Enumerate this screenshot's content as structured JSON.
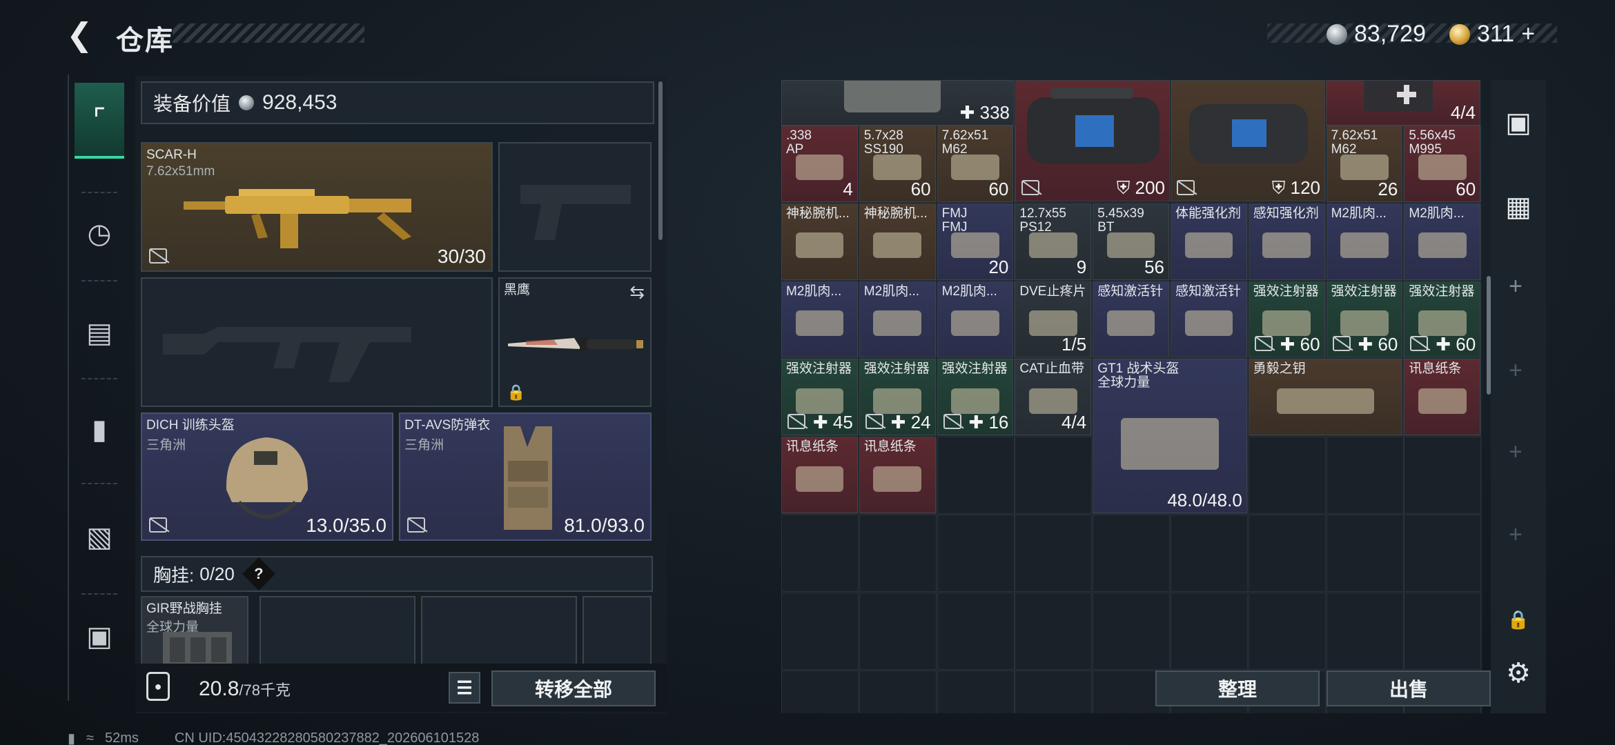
{
  "header": {
    "title": "仓库",
    "currency_silver": "83,729",
    "currency_gold": "311",
    "gold_plus": "+"
  },
  "left_rail": {
    "icons": [
      "pistol-icon",
      "armor-icon",
      "backpack-icon",
      "bag-icon",
      "clipboard-icon",
      "toolbox-icon"
    ]
  },
  "equipment": {
    "value_label": "装备价值",
    "value": "928,453",
    "primary": {
      "name": "SCAR-H",
      "caliber": "7.62x51mm",
      "ammo": "30/30"
    },
    "melee": {
      "name": "黑鹰"
    },
    "helmet": {
      "name": "DICH 训练头盔",
      "brand": "三角洲",
      "durability": "13.0/35.0"
    },
    "armor": {
      "name": "DT-AVS防弹衣",
      "brand": "三角洲",
      "durability": "81.0/93.0"
    },
    "rig": {
      "label": "胸挂:",
      "value": "0/20",
      "help": "?",
      "item_name": "GIR野战胸挂",
      "item_brand": "全球力量"
    },
    "weight": "20.8",
    "weight_cap": "/78千克",
    "transfer_all": "转移全部"
  },
  "stash": {
    "top_qty1": "338",
    "top_qty2": "4/4",
    "bag_qty1": "200",
    "bag_qty2": "120",
    "row1": [
      {
        "name": ".338\nAP",
        "qty": "4"
      },
      {
        "name": "5.7x28\nSS190",
        "qty": "60"
      },
      {
        "name": "7.62x51\nM62",
        "qty": "60"
      },
      {
        "name": "7.62x51\nM62",
        "qty": "26"
      },
      {
        "name": "5.56x45\nM995",
        "qty": "60"
      }
    ],
    "row2": [
      {
        "name": "神秘腕机...",
        "qty": ""
      },
      {
        "name": "神秘腕机...",
        "qty": ""
      },
      {
        "name": "FMJ\nFMJ",
        "qty": "20"
      },
      {
        "name": "12.7x55\nPS12",
        "qty": "9"
      },
      {
        "name": "5.45x39\nBT",
        "qty": "56"
      },
      {
        "name": "体能强化剂",
        "qty": ""
      },
      {
        "name": "感知强化剂",
        "qty": ""
      },
      {
        "name": "M2肌肉...",
        "qty": ""
      },
      {
        "name": "M2肌肉...",
        "qty": ""
      }
    ],
    "row3": [
      {
        "name": "M2肌肉...",
        "qty": ""
      },
      {
        "name": "M2肌肉...",
        "qty": ""
      },
      {
        "name": "M2肌肉...",
        "qty": ""
      },
      {
        "name": "DVE止疼片",
        "qty": "1/5"
      },
      {
        "name": "感知激活针",
        "qty": ""
      },
      {
        "name": "感知激活针",
        "qty": ""
      },
      {
        "name": "强效注射器",
        "qty": "60"
      },
      {
        "name": "强效注射器",
        "qty": "60"
      },
      {
        "name": "强效注射器",
        "qty": "60"
      }
    ],
    "row4": [
      {
        "name": "强效注射器",
        "qty": "45"
      },
      {
        "name": "强效注射器",
        "qty": "24"
      },
      {
        "name": "强效注射器",
        "qty": "16"
      },
      {
        "name": "CAT止血带",
        "qty": "4/4"
      },
      {
        "name": "GT1 战术头盔\n全球力量",
        "qty": "48.0/48.0"
      },
      {
        "name": "勇毅之钥",
        "qty": ""
      },
      {
        "name": "讯息纸条",
        "qty": ""
      }
    ],
    "row5": [
      {
        "name": "讯息纸条",
        "qty": ""
      },
      {
        "name": "讯息纸条",
        "qty": ""
      }
    ],
    "sort": "整理",
    "sell": "出售"
  },
  "status": {
    "ping": "52ms",
    "uid": "CN UID:4504322828058023788​2_202606101528"
  },
  "colors": {
    "accent_green": "#3ad6a5",
    "red_rarity": "#5c2a30",
    "gold_rarity": "#4a3a2c",
    "purple_rarity": "#33385a",
    "green_rarity": "#24443a"
  }
}
